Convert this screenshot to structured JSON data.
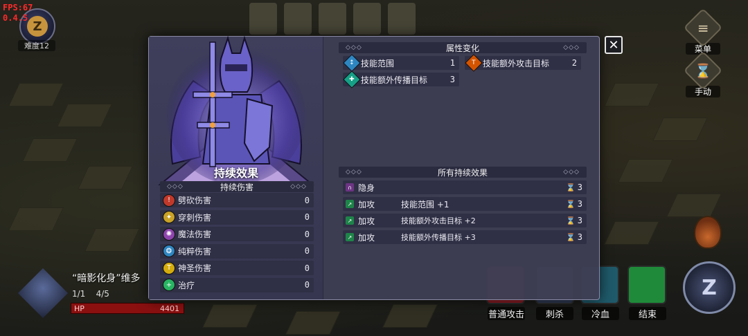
{
  "hud": {
    "fps": "FPS:67",
    "version": "0.4.5",
    "difficulty_icon": "Z",
    "difficulty_label": "难度12",
    "menu_label": "菜单",
    "manual_label": "手动",
    "z_button": "Z"
  },
  "unit": {
    "name": "“暗影化身”维多",
    "stat_1": "1/1",
    "stat_2": "4/5",
    "hp_label": "HP",
    "hp_value": "4401"
  },
  "actions": [
    {
      "label": "普通攻击",
      "color": "#8a1c24"
    },
    {
      "label": "刺杀",
      "color": "#2f3a55"
    },
    {
      "label": "冷血",
      "color": "#1f5a6a"
    },
    {
      "label": "结束",
      "color": "#1f8a3a"
    }
  ],
  "modal": {
    "left_title": "持续效果",
    "dot_header": "持续伤害",
    "dot_header_dots": "◇◇◇",
    "dot_list": [
      {
        "icon": "cleave-damage-icon",
        "glyph": "!",
        "color": "#c0392b",
        "label": "劈砍伤害",
        "value": "0"
      },
      {
        "icon": "pierce-damage-icon",
        "glyph": "✦",
        "color": "#c9a227",
        "label": "穿刺伤害",
        "value": "0"
      },
      {
        "icon": "magic-damage-icon",
        "glyph": "✺",
        "color": "#8e44ad",
        "label": "魔法伤害",
        "value": "0"
      },
      {
        "icon": "pure-damage-icon",
        "glyph": "❂",
        "color": "#2e86c1",
        "label": "纯粹伤害",
        "value": "0"
      },
      {
        "icon": "holy-damage-icon",
        "glyph": "T",
        "color": "#d4ac0d",
        "label": "神圣伤害",
        "value": "0"
      },
      {
        "icon": "heal-icon",
        "glyph": "+",
        "color": "#28b463",
        "label": "治疗",
        "value": "0"
      }
    ],
    "attr_header": "属性变化",
    "attributes": [
      {
        "icon": "skill-range-icon",
        "glyph": "↕",
        "color": "#2e86c1",
        "label": "技能范围",
        "value": "1"
      },
      {
        "icon": "extra-target-icon",
        "glyph": "T",
        "color": "#d35400",
        "label": "技能额外攻击目标",
        "value": "2"
      },
      {
        "icon": "spread-target-icon",
        "glyph": "✚",
        "color": "#16a085",
        "label": "技能额外传播目标",
        "value": "3"
      }
    ],
    "effects_header": "所有持续效果",
    "effects": [
      {
        "icon": "stealth-icon",
        "glyph": "∩",
        "color": "#6c3483",
        "name": "隐身",
        "desc": "",
        "duration": "3"
      },
      {
        "icon": "attack-up-icon",
        "glyph": "↗",
        "color": "#1e8449",
        "name": "加攻",
        "desc": "技能范围 +1",
        "duration": "3"
      },
      {
        "icon": "attack-up-icon",
        "glyph": "↗",
        "color": "#1e8449",
        "name": "加攻",
        "desc": "技能额外攻击目标 +2",
        "duration": "3"
      },
      {
        "icon": "attack-up-icon",
        "glyph": "↗",
        "color": "#1e8449",
        "name": "加攻",
        "desc": "技能额外传播目标 +3",
        "duration": "3"
      }
    ],
    "close_glyph": "✕"
  }
}
